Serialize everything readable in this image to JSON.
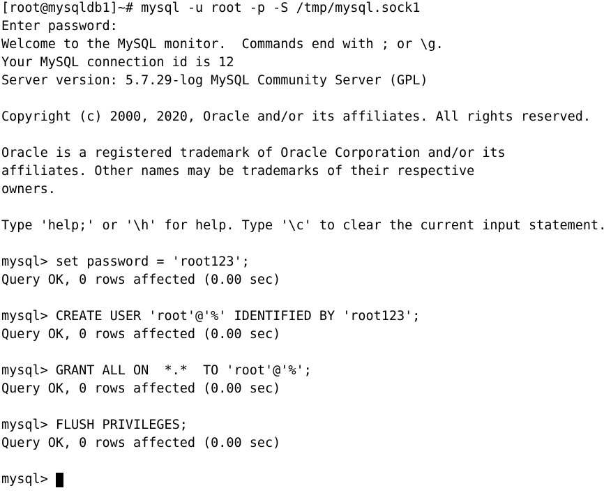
{
  "terminal": {
    "title": "root@mysqldb1 terminal",
    "background_color": "#ffffff",
    "foreground_color": "#000000",
    "cursor": {
      "name": "block-cursor",
      "shape": "block",
      "color": "#000000"
    },
    "prompt_shell": "[root@mysqldb1]~#",
    "prompt_mysql": "mysql>",
    "lines": [
      "[root@mysqldb1]~# mysql -u root -p -S /tmp/mysql.sock1",
      "Enter password:",
      "Welcome to the MySQL monitor.  Commands end with ; or \\g.",
      "Your MySQL connection id is 12",
      "Server version: 5.7.29-log MySQL Community Server (GPL)",
      "",
      "Copyright (c) 2000, 2020, Oracle and/or its affiliates. All rights reserved.",
      "",
      "Oracle is a registered trademark of Oracle Corporation and/or its",
      "affiliates. Other names may be trademarks of their respective",
      "owners.",
      "",
      "Type 'help;' or '\\h' for help. Type '\\c' to clear the current input statement.",
      "",
      "mysql> set password = 'root123';",
      "Query OK, 0 rows affected (0.00 sec)",
      "",
      "mysql> CREATE USER 'root'@'%' IDENTIFIED BY 'root123';",
      "Query OK, 0 rows affected (0.00 sec)",
      "",
      "mysql> GRANT ALL ON  *.*  TO 'root'@'%';",
      "Query OK, 0 rows affected (0.00 sec)",
      "",
      "mysql> FLUSH PRIVILEGES;",
      "Query OK, 0 rows affected (0.00 sec)",
      ""
    ],
    "last_prompt": "mysql> "
  }
}
